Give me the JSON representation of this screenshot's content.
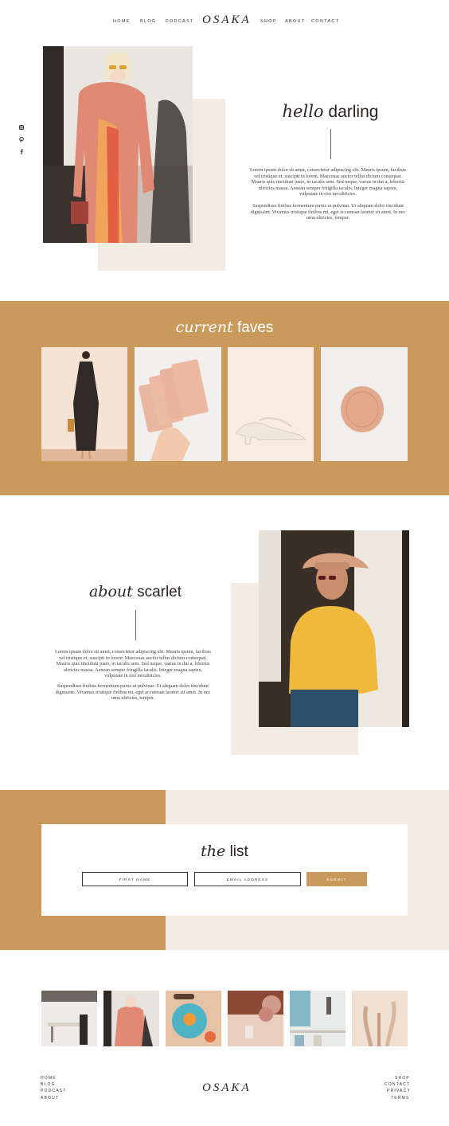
{
  "header": {
    "logo": "OSAKA",
    "nav_left": [
      "HOME",
      "BLOG",
      "PODCAST"
    ],
    "nav_right": [
      "SHOP",
      "ABOUT",
      "CONTACT"
    ]
  },
  "social_icons": [
    "instagram-icon",
    "pinterest-icon",
    "facebook-icon"
  ],
  "hero": {
    "heading_script": "hello",
    "heading_rest": "darling",
    "paragraph_1": "Lorem ipsum dolor sit amet, consectetur adipiscing elit. Mauris ipsum, facilisis vel tristique et, suscipit in lorem. Maecenas auctor tellus dictum consequat. Mauris quis tincidunt justo, in iaculis sem. Sed neque, varius in dui a, lobortis ultricies massa. Aenean semper fringilla iaculis. Integer magna sapien, vulputate in nisi necultricies.",
    "paragraph_2": "Suspendisse finibus fermentum purus ut pulvinar. Ut aliquam dolor tincidunt dignissim. Vivamus tristique finibus mi, eget accumsan laoreet sit amet. In nec urna ultricies, tempor."
  },
  "faves": {
    "heading_script": "current",
    "heading_rest": "faves",
    "items": [
      "black-slip-dress",
      "pink-cards",
      "clear-heel-sandals",
      "pink-pillow"
    ]
  },
  "about": {
    "heading_script": "about",
    "heading_rest": "scarlet",
    "paragraph_1": "Lorem ipsum dolor sit amet, consectetur adipiscing elit. Mauris ipsum, facilisis vel tristique et, suscipit in lorem. Maecenas auctor tellus dictum consequat. Mauris quis tincidunt justo, in iaculis sem. Sed neque, varius in dui a, lobortis ultricies massa. Aenean semper fringilla iaculis. Integer magna sapien, vulputate in nisi necultricies.",
    "paragraph_2": "Suspendisse finibus fermentum purus ut pulvinar. Ut aliquam dolor tincidunt dignissim. Vivamus tristique finibus mi, eget accumsan laoreet sit amet. In nec urna ultricies, tempor."
  },
  "newsletter": {
    "heading_script": "the",
    "heading_rest": "list",
    "first_name_placeholder": "FIRST NAME",
    "email_placeholder": "EMAIL ADDRESS",
    "submit_label": "SUBMIT"
  },
  "footer": {
    "logo": "OSAKA",
    "links_left": [
      "HOME",
      "BLOG",
      "PODCAST",
      "ABOUT"
    ],
    "links_right": [
      "SHOP",
      "CONTACT",
      "PRIVACY",
      "TERMS"
    ]
  },
  "colors": {
    "gold": "#c99a5b",
    "cream": "#f3ece3",
    "text": "#2a2522"
  }
}
